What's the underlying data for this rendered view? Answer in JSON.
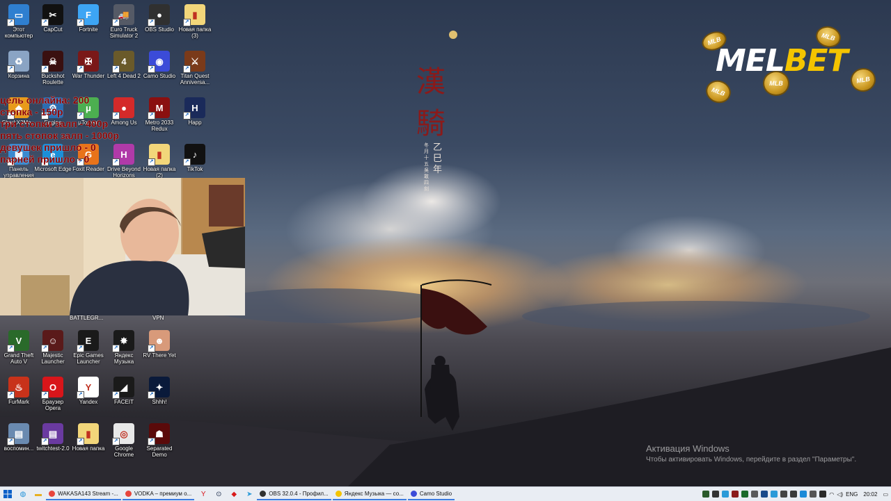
{
  "desktop": {
    "icons": [
      {
        "label": "Этот компьютер",
        "glyph": "▭",
        "bg": "#2f7fd0",
        "col": 0,
        "row": 0
      },
      {
        "label": "CapCut",
        "glyph": "✂",
        "bg": "#111111",
        "col": 1,
        "row": 0
      },
      {
        "label": "Fortnite",
        "glyph": "F",
        "bg": "#3da5f4",
        "col": 2,
        "row": 0
      },
      {
        "label": "Euro Truck Simulator 2",
        "glyph": "🚚",
        "bg": "#555a66",
        "col": 3,
        "row": 0
      },
      {
        "label": "OBS Studio",
        "glyph": "●",
        "bg": "#303030",
        "col": 4,
        "row": 0
      },
      {
        "label": "Новая папка (3)",
        "glyph": "▮",
        "bg": "#f2d67a",
        "col": 5,
        "row": 0
      },
      {
        "label": "Корзина",
        "glyph": "♻",
        "bg": "#8aa4c4",
        "col": 0,
        "row": 1
      },
      {
        "label": "Buckshot Roulette",
        "glyph": "☠",
        "bg": "#3a1010",
        "col": 1,
        "row": 1
      },
      {
        "label": "War Thunder",
        "glyph": "✠",
        "bg": "#7a1818",
        "col": 2,
        "row": 1
      },
      {
        "label": "Left 4 Dead 2",
        "glyph": "4",
        "bg": "#6a5a2a",
        "col": 3,
        "row": 1
      },
      {
        "label": "Camo Studio",
        "glyph": "◉",
        "bg": "#3b4bd8",
        "col": 4,
        "row": 1
      },
      {
        "label": "Titan Quest Anniversa...",
        "glyph": "⚔",
        "bg": "#7a3a1a",
        "col": 5,
        "row": 1
      },
      {
        "label": "SharkX3Mo...",
        "glyph": "◆",
        "bg": "#e89b1a",
        "col": 0,
        "row": 2
      },
      {
        "label": "Engine",
        "glyph": "⚙",
        "bg": "#2b6cb0",
        "col": 1,
        "row": 2
      },
      {
        "label": "μTorrent",
        "glyph": "μ",
        "bg": "#4caf50",
        "col": 2,
        "row": 2
      },
      {
        "label": "Among Us",
        "glyph": "●",
        "bg": "#d42a2a",
        "col": 3,
        "row": 2
      },
      {
        "label": "Metro 2033 Redux",
        "glyph": "M",
        "bg": "#8a1010",
        "col": 4,
        "row": 2
      },
      {
        "label": "Happ",
        "glyph": "H",
        "bg": "#1a2a5a",
        "col": 5,
        "row": 2
      },
      {
        "label": "Панель управления",
        "glyph": "▦",
        "bg": "#3a8ad0",
        "col": 0,
        "row": 3
      },
      {
        "label": "Microsoft Edge",
        "glyph": "e",
        "bg": "#1b8fd8",
        "col": 1,
        "row": 3
      },
      {
        "label": "Foxit Reader",
        "glyph": "G",
        "bg": "#e8731a",
        "col": 2,
        "row": 3
      },
      {
        "label": "Drive Beyond Horizons",
        "glyph": "H",
        "bg": "#b03aa8",
        "col": 3,
        "row": 3
      },
      {
        "label": "Новая папка (2)",
        "glyph": "▮",
        "bg": "#f2d67a",
        "col": 4,
        "row": 3
      },
      {
        "label": "TikTok",
        "glyph": "♪",
        "bg": "#111111",
        "col": 5,
        "row": 3
      },
      {
        "label": "Grand Theft Auto V",
        "glyph": "V",
        "bg": "#2a6a2a",
        "col": 0,
        "row": 7
      },
      {
        "label": "Majestic Launcher",
        "glyph": "☺",
        "bg": "#5a1a1a",
        "col": 1,
        "row": 7
      },
      {
        "label": "Epic Games Launcher",
        "glyph": "E",
        "bg": "#1a1a1a",
        "col": 2,
        "row": 7
      },
      {
        "label": "Яндекс Музыка",
        "glyph": "✸",
        "bg": "#1a1a1a",
        "col": 3,
        "row": 7
      },
      {
        "label": "RV There Yet",
        "glyph": "☻",
        "bg": "#d89a7a",
        "col": 4,
        "row": 7
      },
      {
        "label": "FurMark",
        "glyph": "♨",
        "bg": "#c8321a",
        "col": 0,
        "row": 8
      },
      {
        "label": "Браузер Opera",
        "glyph": "O",
        "bg": "#d8151a",
        "col": 1,
        "row": 8
      },
      {
        "label": "Yandex",
        "glyph": "Y",
        "bg": "#ffffff",
        "col": 2,
        "row": 8
      },
      {
        "label": "FACEIT",
        "glyph": "◢",
        "bg": "#1a1a1a",
        "col": 3,
        "row": 8
      },
      {
        "label": "Shhh!",
        "glyph": "✦",
        "bg": "#0a1a3a",
        "col": 4,
        "row": 8
      },
      {
        "label": "воспомин...",
        "glyph": "▤",
        "bg": "#6a8ab0",
        "col": 0,
        "row": 9
      },
      {
        "label": "twitchtest-2.0",
        "glyph": "▤",
        "bg": "#6a3aa0",
        "col": 1,
        "row": 9
      },
      {
        "label": "Новая папка",
        "glyph": "▮",
        "bg": "#f2d67a",
        "col": 2,
        "row": 9
      },
      {
        "label": "Google Chrome",
        "glyph": "◎",
        "bg": "#e8e8e8",
        "col": 3,
        "row": 9
      },
      {
        "label": "Separated Demo",
        "glyph": "☗",
        "bg": "#5a0a0a",
        "col": 4,
        "row": 9
      }
    ],
    "webcam_labels": [
      "BATTLEGR...",
      "VPN"
    ]
  },
  "overlay": {
    "lines": [
      "цель онлайна: 200",
      "стопка - 150р",
      "три стопки залп - 400р",
      "пять стопок залп - 1000р",
      "девушек пришло - 0",
      "парней пришло - 0"
    ]
  },
  "wallpaper": {
    "calligraphy": "漢騎",
    "small_text_1": "乙巳年",
    "small_text_2": "冬月十五　吳敢四刻"
  },
  "ad": {
    "brand_left": "MEL",
    "brand_right": "BET",
    "coin_label": "MLB"
  },
  "activation": {
    "title": "Активация Windows",
    "subtitle": "Чтобы активировать Windows, перейдите в раздел \"Параметры\"."
  },
  "taskbar": {
    "windows": [
      {
        "label": "WAKASA143 Stream -...",
        "color": "#e8453c"
      },
      {
        "label": "VODKA – премиум о...",
        "color": "#e8453c"
      },
      {
        "label": "OBS 32.0.4 - Профил...",
        "color": "#303030"
      },
      {
        "label": "Яндекс Музыка — со...",
        "color": "#f4c400"
      },
      {
        "label": "Camo Studio",
        "color": "#3b4bd8"
      }
    ],
    "lang": "ENG",
    "time": "20:02"
  }
}
